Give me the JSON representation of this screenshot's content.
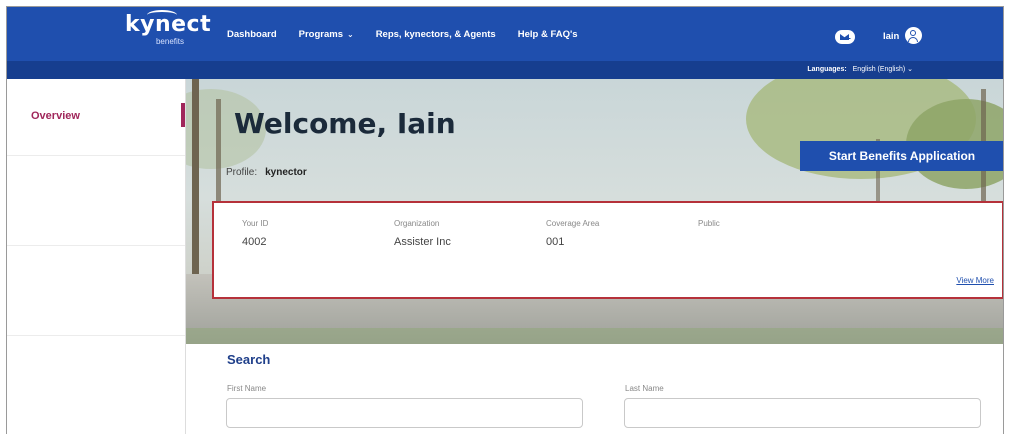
{
  "header": {
    "logo_text": "kynect",
    "logo_sub": "benefits",
    "nav": [
      {
        "label": "Dashboard",
        "has_dropdown": false
      },
      {
        "label": "Programs",
        "has_dropdown": true
      },
      {
        "label": "Reps, kynectors, & Agents",
        "has_dropdown": false
      },
      {
        "label": "Help & FAQ's",
        "has_dropdown": false
      }
    ],
    "mail_icon": "mail-icon",
    "user_name": "Iain",
    "user_icon": "user-icon",
    "language_label": "Languages:",
    "language_value": "English (English)"
  },
  "sidebar": {
    "items": [
      {
        "label": "Overview",
        "active": true
      }
    ]
  },
  "hero": {
    "welcome": "Welcome, Iain",
    "profile_label": "Profile:",
    "profile_value": "kynector",
    "start_button": "Start Benefits Application"
  },
  "info": {
    "columns": [
      {
        "label": "Your ID",
        "value": "4002"
      },
      {
        "label": "Organization",
        "value": "Assister Inc"
      },
      {
        "label": "Coverage Area",
        "value": "001"
      },
      {
        "label": "Public",
        "value": ""
      }
    ],
    "view_more": "View More"
  },
  "search": {
    "title": "Search",
    "first_name_label": "First Name",
    "last_name_label": "Last Name",
    "first_name_value": "",
    "last_name_value": ""
  },
  "colors": {
    "primary": "#1f4fae",
    "accent": "#a0265a",
    "highlight_border": "#b5313a"
  }
}
